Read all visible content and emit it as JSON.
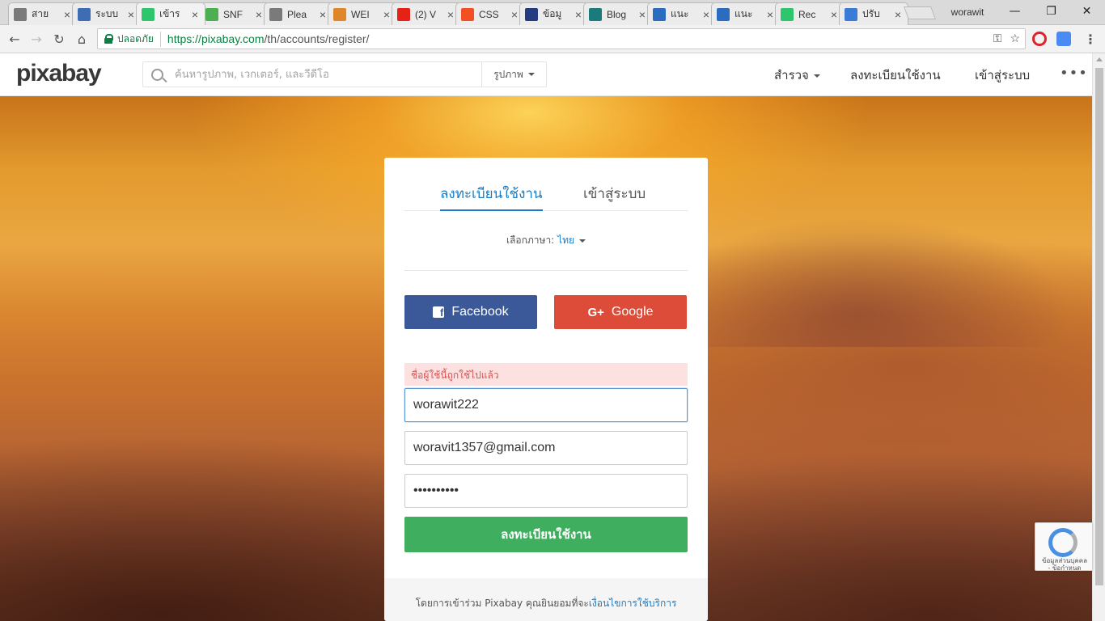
{
  "browser": {
    "tabs": [
      {
        "title": "สาย",
        "icon": "document-icon",
        "color": "#7a7a7a"
      },
      {
        "title": "ระบบ",
        "icon": "globe-icon",
        "color": "#3e6db5"
      },
      {
        "title": "เข้าร",
        "icon": "pixabay-favicon",
        "color": "#2ec66d",
        "active": true
      },
      {
        "title": "SNF",
        "icon": "bar-chart-icon",
        "color": "#4caf50"
      },
      {
        "title": "Plea",
        "icon": "document-icon",
        "color": "#7a7a7a"
      },
      {
        "title": "WEI",
        "icon": "gear-icon",
        "color": "#e0862a"
      },
      {
        "title": "(2) V",
        "icon": "youtube-icon",
        "color": "#e62117"
      },
      {
        "title": "CSS",
        "icon": "windows-icon",
        "color": "#f25022"
      },
      {
        "title": "ข้อมู",
        "icon": "paypal-icon",
        "color": "#253b80"
      },
      {
        "title": "Blog",
        "icon": "blog-icon",
        "color": "#1b7a7a"
      },
      {
        "title": "แนะ",
        "icon": "r-icon",
        "color": "#2a6cbf"
      },
      {
        "title": "แนะ",
        "icon": "r-icon",
        "color": "#2a6cbf"
      },
      {
        "title": "Rec",
        "icon": "pixabay-favicon",
        "color": "#2ec66d"
      },
      {
        "title": "ปรับ",
        "icon": "layout-icon",
        "color": "#3a7bd5"
      }
    ],
    "profile_name": "worawit",
    "security_label": "ปลอดภัย",
    "url_host": "https://pixabay.com",
    "url_path": "/th/accounts/register/"
  },
  "site": {
    "logo": "pixabay",
    "search_placeholder": "ค้นหารูปภาพ, เวกเตอร์, และวีดีโอ",
    "media_type": "รูปภาพ",
    "nav": {
      "explore": "สำรวจ",
      "register": "ลงทะเบียนใช้งาน",
      "login": "เข้าสู่ระบบ"
    }
  },
  "form": {
    "tab_register": "ลงทะเบียนใช้งาน",
    "tab_login": "เข้าสู่ระบบ",
    "language_label": "เลือกภาษา:",
    "language_value": "ไทย",
    "facebook_label": "Facebook",
    "google_label": "Google",
    "error_message": "ชื่อผู้ใช้นี้ถูกใช้ไปแล้ว",
    "username_value": "worawit222",
    "email_value": "woravit1357@gmail.com",
    "password_value": "••••••••••",
    "submit_label": "ลงทะเบียนใช้งาน",
    "terms_prefix": "โดยการเข้าร่วม Pixabay คุณยินยอมที่จะ",
    "terms_link": "เงื่อนไขการใช้บริการ"
  },
  "recaptcha": {
    "line1": "ข้อมูลส่วนบุคคล",
    "line2": "- ข้อกำหนด"
  },
  "colors": {
    "accent": "#1a7cc4",
    "facebook": "#3b5998",
    "google": "#dd4b39",
    "submit": "#3fae5e",
    "error_bg": "#fde0e0"
  }
}
